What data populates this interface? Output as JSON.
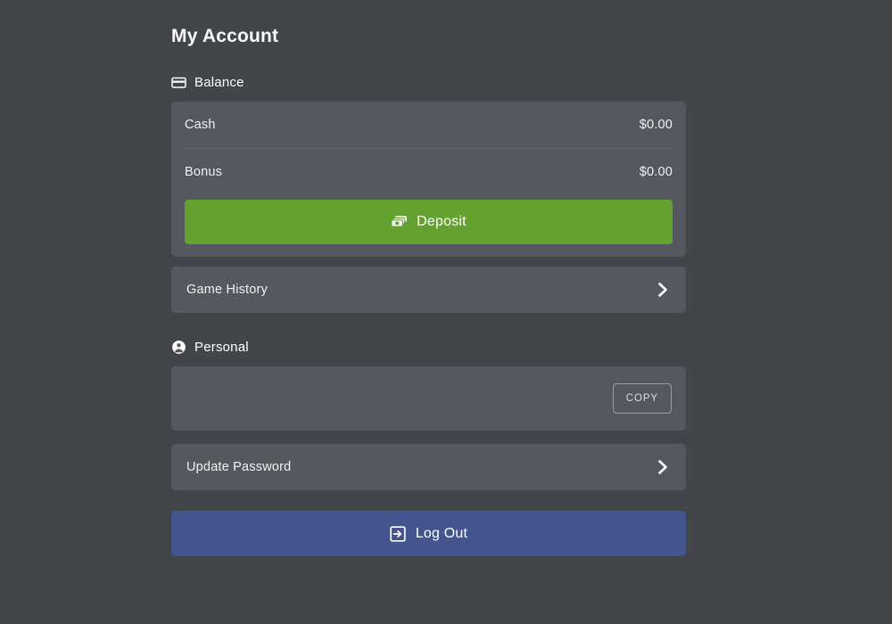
{
  "page": {
    "title": "My Account",
    "background_color": "#424549",
    "card_color": "#55585e"
  },
  "balance_section": {
    "heading": "Balance",
    "icon": "credit-card-icon",
    "rows": [
      {
        "label": "Cash",
        "value": "$0.00"
      },
      {
        "label": "Bonus",
        "value": "$0.00"
      }
    ],
    "deposit_button": {
      "label": "Deposit",
      "icon": "money-bills-icon",
      "color": "#63a22f"
    },
    "game_history": {
      "label": "Game History",
      "icon": "chevron-right-icon"
    }
  },
  "personal_section": {
    "heading": "Personal",
    "icon": "user-circle-icon",
    "copy_field": {
      "value": "",
      "placeholder": "",
      "button_label": "COPY"
    },
    "update_password": {
      "label": "Update Password",
      "icon": "chevron-right-icon"
    }
  },
  "logout_button": {
    "label": "Log Out",
    "icon": "sign-out-icon",
    "color": "#44548f"
  }
}
